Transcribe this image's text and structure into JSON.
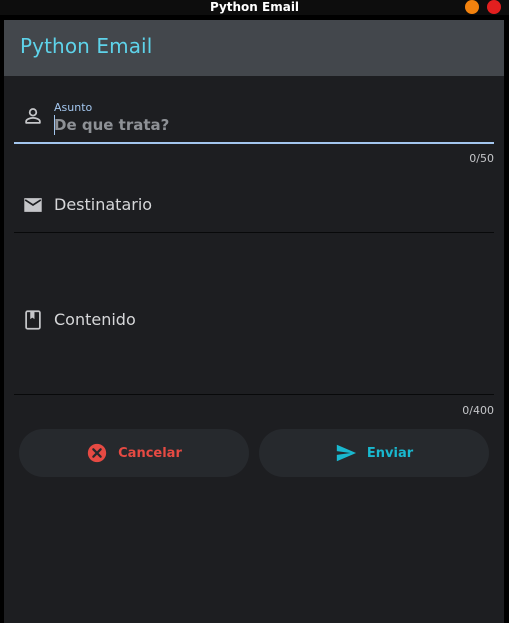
{
  "window": {
    "title": "Python Email",
    "controls": {
      "minimize_color": "#f2820e",
      "close_color": "#e21f1f"
    }
  },
  "appbar": {
    "title": "Python Email",
    "title_color": "#5ed3ea",
    "background": "#43474c"
  },
  "form": {
    "subject": {
      "label": "Asunto",
      "placeholder": "De que trata?",
      "value": "",
      "counter": "0/50",
      "icon": "person-icon"
    },
    "recipient": {
      "label": "Destinatario",
      "value": "",
      "icon": "mail-icon"
    },
    "content": {
      "label": "Contenido",
      "value": "",
      "counter": "0/400",
      "icon": "book-icon"
    }
  },
  "actions": {
    "cancel": {
      "label": "Cancelar",
      "icon": "cancel-circle-icon",
      "color": "#e64a43"
    },
    "send": {
      "label": "Enviar",
      "icon": "send-icon",
      "color": "#19b8cf"
    }
  },
  "colors": {
    "background": "#1d1e21",
    "accent": "#a3c6ee",
    "button_bg": "#26292d"
  }
}
